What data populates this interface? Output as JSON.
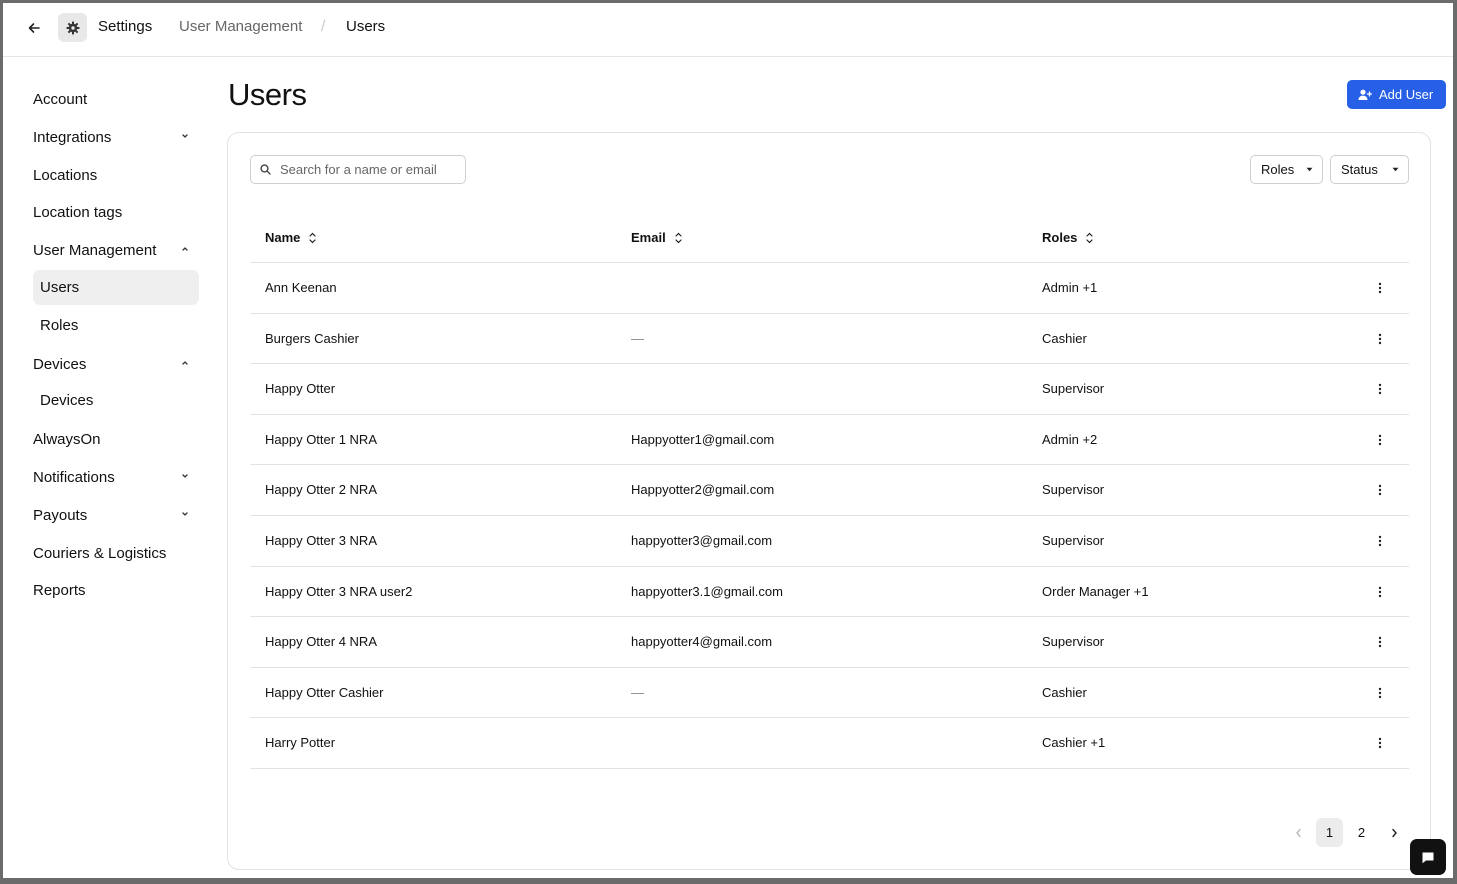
{
  "breadcrumb": {
    "settings": "Settings",
    "user_management": "User Management",
    "separator": "/",
    "current": "Users"
  },
  "sidebar": {
    "items": [
      {
        "label": "Account"
      },
      {
        "label": "Integrations"
      },
      {
        "label": "Locations"
      },
      {
        "label": "Location tags"
      },
      {
        "label": "User Management"
      },
      {
        "label": "Users"
      },
      {
        "label": "Roles"
      },
      {
        "label": "Devices"
      },
      {
        "label": "Devices"
      },
      {
        "label": "AlwaysOn"
      },
      {
        "label": "Notifications"
      },
      {
        "label": "Payouts"
      },
      {
        "label": "Couriers & Logistics"
      },
      {
        "label": "Reports"
      }
    ]
  },
  "page": {
    "title": "Users",
    "add_user_label": "Add User"
  },
  "search": {
    "placeholder": "Search for a name or email",
    "value": ""
  },
  "filters": {
    "roles": "Roles",
    "status": "Status"
  },
  "table": {
    "headers": {
      "name": "Name",
      "email": "Email",
      "roles": "Roles"
    },
    "rows": [
      {
        "name": "Ann Keenan",
        "email": "",
        "roles": "Admin +1"
      },
      {
        "name": "Burgers Cashier",
        "email": "—",
        "roles": "Cashier"
      },
      {
        "name": "Happy Otter",
        "email": "",
        "roles": "Supervisor"
      },
      {
        "name": "Happy Otter 1 NRA",
        "email": "Happyotter1@gmail.com",
        "roles": "Admin +2"
      },
      {
        "name": "Happy Otter 2 NRA",
        "email": "Happyotter2@gmail.com",
        "roles": "Supervisor"
      },
      {
        "name": "Happy Otter 3 NRA",
        "email": "happyotter3@gmail.com",
        "roles": "Supervisor"
      },
      {
        "name": "Happy Otter 3 NRA user2",
        "email": "happyotter3.1@gmail.com",
        "roles": "Order Manager +1"
      },
      {
        "name": "Happy Otter 4 NRA",
        "email": "happyotter4@gmail.com",
        "roles": "Supervisor"
      },
      {
        "name": "Happy Otter Cashier",
        "email": "—",
        "roles": "Cashier"
      },
      {
        "name": "Harry Potter",
        "email": "",
        "roles": "Cashier +1"
      }
    ]
  },
  "pagination": {
    "pages": [
      "1",
      "2"
    ],
    "current": "1"
  },
  "colors": {
    "accent": "#2760e6",
    "active_nav": "#efefef",
    "border": "#e3e3e3"
  }
}
